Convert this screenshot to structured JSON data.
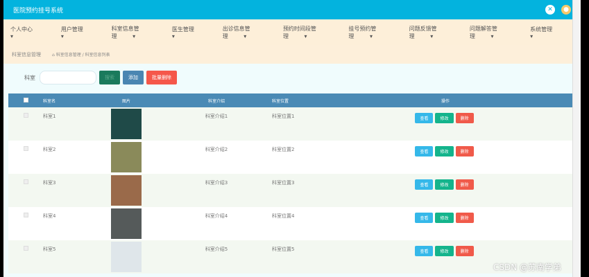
{
  "header": {
    "title": "医院预约挂号系统"
  },
  "nav": [
    "个人中心",
    "用户管理",
    "科室信息管理",
    "医生管理",
    "出诊信息管理",
    "预约时间段管理",
    "挂号预约管理",
    "问题反馈管理",
    "问题解答管理",
    "系统管理"
  ],
  "breadcrumb": {
    "current": "科室信息管理",
    "path": "科室信息管理 / 科室信息列表"
  },
  "search": {
    "label": "科室",
    "value": "",
    "search": "搜索",
    "add": "添加",
    "batch_delete": "批量删除"
  },
  "table": {
    "headers": [
      "科室名",
      "图片",
      "科室介绍",
      "科室位置",
      "操作"
    ],
    "rows": [
      {
        "name": "科室1",
        "intro": "科室介绍1",
        "loc": "科室位置1"
      },
      {
        "name": "科室2",
        "intro": "科室介绍2",
        "loc": "科室位置2"
      },
      {
        "name": "科室3",
        "intro": "科室介绍3",
        "loc": "科室位置3"
      },
      {
        "name": "科室4",
        "intro": "科室介绍4",
        "loc": "科室位置4"
      },
      {
        "name": "科室5",
        "intro": "科室介绍5",
        "loc": "科室位置5"
      }
    ],
    "actions": {
      "view": "查看",
      "edit": "修改",
      "delete": "删除"
    }
  },
  "watermark": "CSDN @苏南学弟",
  "colors": {
    "topbar": "#03b3de",
    "header": "#4a8ab5",
    "view": "#35b8e9",
    "edit": "#14b48c",
    "delete": "#f05a4a"
  }
}
